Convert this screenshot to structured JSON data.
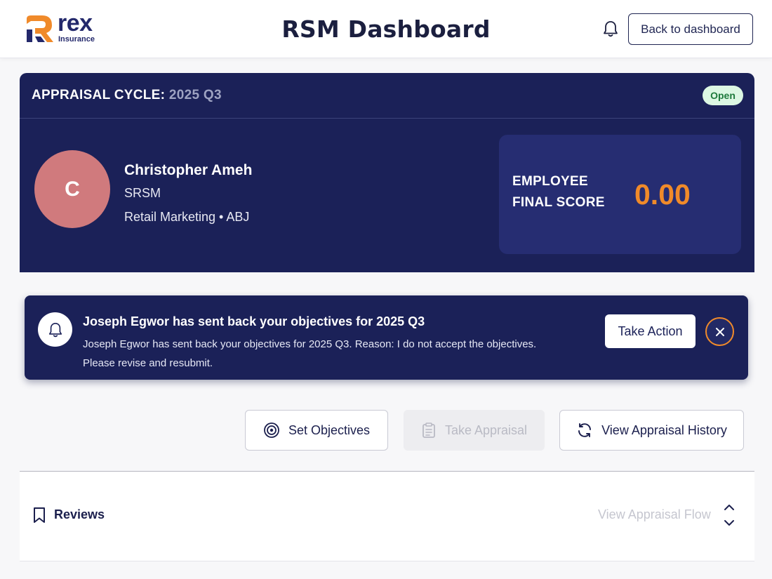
{
  "header": {
    "logo_text": "rex",
    "logo_subtext": "Insurance",
    "title": "RSM Dashboard",
    "back_button": "Back to dashboard"
  },
  "cycle": {
    "label": "APPRAISAL CYCLE:",
    "value": "2025 Q3",
    "status": "Open"
  },
  "employee": {
    "initial": "C",
    "name": "Christopher Ameh",
    "role": "SRSM",
    "department": "Retail Marketing • ABJ",
    "score_label_line1": "EMPLOYEE",
    "score_label_line2": "FINAL SCORE",
    "final_score": "0.00"
  },
  "alert": {
    "title": "Joseph Egwor has sent back your objectives for 2025 Q3",
    "body_line1": "Joseph Egwor has sent back your objectives for 2025 Q3. Reason: I do not accept the objectives.",
    "body_line2": "Please revise and resubmit.",
    "action_button": "Take Action"
  },
  "actions": {
    "set_objectives": "Set Objectives",
    "take_appraisal": "Take Appraisal",
    "view_history": "View Appraisal History"
  },
  "reviews": {
    "label": "Reviews",
    "flow_link": "View Appraisal Flow"
  },
  "colors": {
    "navy": "#1b2158",
    "accent_orange": "#f08a2a",
    "open_badge_bg": "#dcf7e3",
    "avatar": "#d07a7d"
  }
}
